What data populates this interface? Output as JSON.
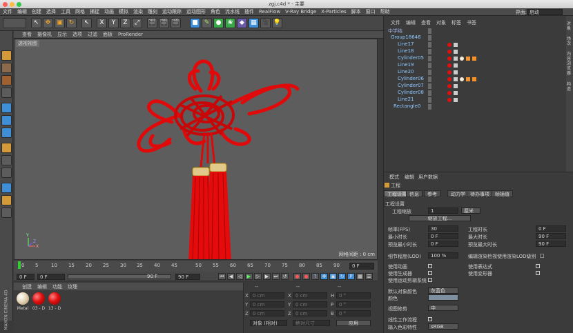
{
  "window": {
    "title": "zgj.c4d * - 主要"
  },
  "menubar": {
    "items": [
      "文件",
      "编辑",
      "创建",
      "选择",
      "工具",
      "网格",
      "捕捉",
      "动画",
      "模拟",
      "渲染",
      "雕刻",
      "运动跟踪",
      "运动图形",
      "角色",
      "流水线",
      "插件",
      "RealFlow",
      "V-Ray Bridge",
      "X-Particles",
      "脚本",
      "窗口",
      "帮助"
    ],
    "layout_label": "界面:",
    "layout_value": "启动"
  },
  "viewport": {
    "menu": [
      "查看",
      "摄像机",
      "显示",
      "选项",
      "过滤",
      "面板",
      "ProRender"
    ],
    "view_label": "透视视图",
    "grid_label": "网格间距 : 0 cm",
    "axes": [
      "Y",
      "X",
      "Z"
    ]
  },
  "timeline": {
    "ticks": [
      "0",
      "5",
      "10",
      "15",
      "20",
      "25",
      "30",
      "35",
      "40",
      "45",
      "50",
      "55",
      "60",
      "65",
      "70",
      "75",
      "80",
      "85",
      "90"
    ],
    "current_frame": "0 F"
  },
  "transport": {
    "start": "0 F",
    "field2": "0 F",
    "end_a": "90 F",
    "end_b": "90 F"
  },
  "materials": {
    "menu": [
      "创建",
      "编辑",
      "功能",
      "纹理"
    ],
    "items": [
      {
        "label": "Metal",
        "color": "#f0e6d2"
      },
      {
        "label": "03 - D",
        "color": "#e01010"
      },
      {
        "label": "13 - D",
        "color": "#e01010"
      }
    ],
    "brand": "MAXON CINEMA 4D"
  },
  "coords": {
    "header": [
      "--",
      "--",
      "--"
    ],
    "labels": [
      "X",
      "Y",
      "Z"
    ],
    "labels2": [
      "X",
      "Y",
      "Z"
    ],
    "labels3": [
      "H",
      "P",
      "B"
    ],
    "value": "0 cm",
    "angle": "0 °",
    "object_mode": "对象 (相对)",
    "size_mode": "绝对尺寸",
    "apply": "应用"
  },
  "objects": {
    "menu": [
      "文件",
      "编辑",
      "查看",
      "对象",
      "标签",
      "书签"
    ],
    "rows": [
      {
        "name": "中学结",
        "indent": 0
      },
      {
        "name": "Group18646",
        "indent": 1
      },
      {
        "name": "Line17",
        "indent": 2
      },
      {
        "name": "Line18",
        "indent": 2
      },
      {
        "name": "Cylinder05",
        "indent": 2
      },
      {
        "name": "Line19",
        "indent": 2
      },
      {
        "name": "Line20",
        "indent": 2
      },
      {
        "name": "Cylinder06",
        "indent": 2
      },
      {
        "name": "Cylinder07",
        "indent": 2
      },
      {
        "name": "Cylinder08",
        "indent": 2
      },
      {
        "name": "Line21",
        "indent": 2
      },
      {
        "name": "Rectangle0",
        "indent": 1
      }
    ],
    "side_tabs": [
      "对象",
      "场次",
      "内容浏览器",
      "构造"
    ]
  },
  "attributes": {
    "menu": [
      "模式",
      "编辑",
      "用户数据"
    ],
    "title": "工程",
    "tabs": [
      "工程设置",
      "信息",
      "参考",
      "动力学",
      "待办事项",
      "帧插值"
    ],
    "section": "工程设置",
    "scale_label": "工程缩放",
    "scale_value": "1",
    "scale_unit": "厘米",
    "scale_button": "缩放工程...",
    "fps_label": "帧率(FPS)",
    "fps_value": "30",
    "duration_label": "工程时长",
    "duration_value": "0 F",
    "min_time_label": "最小时长",
    "min_time_value": "0 F",
    "max_time_label": "最大时长",
    "max_time_value": "90 F",
    "prev_min_label": "预览最小时长",
    "prev_min_value": "0 F",
    "prev_max_label": "预览最大时长",
    "prev_max_value": "90 F",
    "lod_label": "细节程度(LOD)",
    "lod_value": "100 %",
    "lod_render_label": "编辑渲染检视使用渲染LOD级别",
    "checks_left": [
      "使用动画",
      "使用生成器",
      "使用运动剪辑系统"
    ],
    "checks_right": [
      "使用表达式",
      "使用变形器"
    ],
    "default_color_label": "默认对象颜色",
    "default_color_value": "灰蓝色",
    "color_label": "颜色",
    "clipping_label": "视图修剪",
    "clipping_value": "中",
    "linear_label": "线性工作流程",
    "input_color_label": "输入色彩特性",
    "input_color_value": "sRGB"
  }
}
